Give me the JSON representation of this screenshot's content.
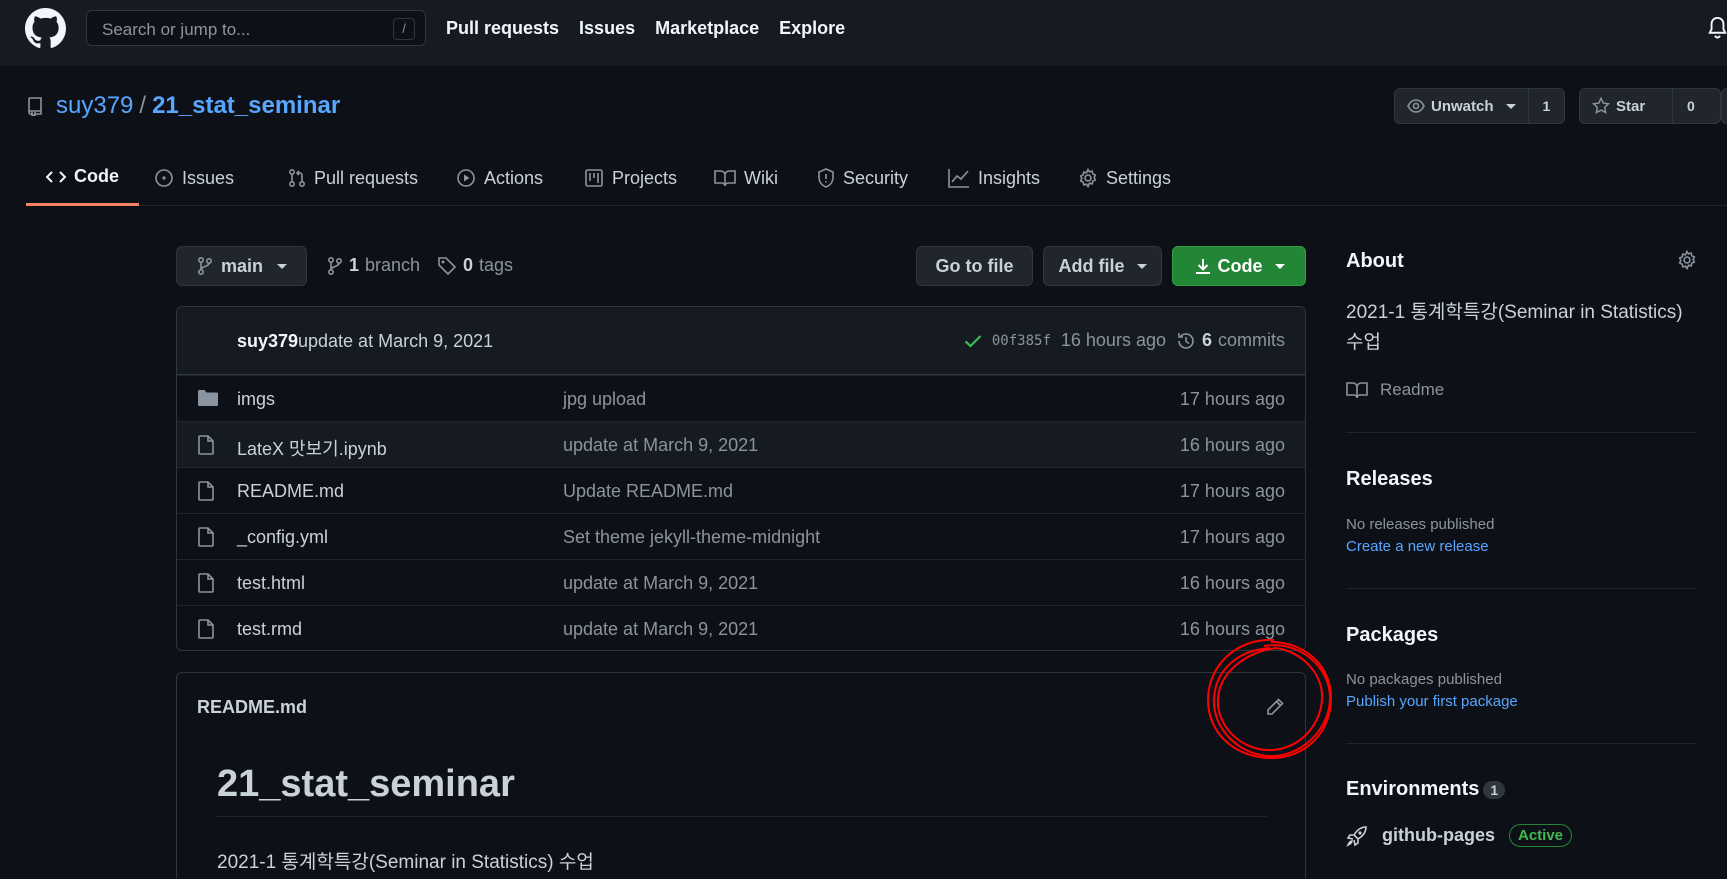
{
  "header": {
    "search_placeholder": "Search or jump to...",
    "search_shortcut": "/",
    "nav": [
      "Pull requests",
      "Issues",
      "Marketplace",
      "Explore"
    ]
  },
  "repo": {
    "owner": "suy379",
    "separator": "/",
    "name": "21_stat_seminar",
    "watch_label": "Unwatch",
    "watch_count": "1",
    "star_label": "Star",
    "star_count": "0"
  },
  "tabs": [
    {
      "label": "Code",
      "icon": "code-icon"
    },
    {
      "label": "Issues",
      "icon": "issue-icon"
    },
    {
      "label": "Pull requests",
      "icon": "pull-request-icon"
    },
    {
      "label": "Actions",
      "icon": "play-icon"
    },
    {
      "label": "Projects",
      "icon": "project-icon"
    },
    {
      "label": "Wiki",
      "icon": "book-icon"
    },
    {
      "label": "Security",
      "icon": "shield-icon"
    },
    {
      "label": "Insights",
      "icon": "graph-icon"
    },
    {
      "label": "Settings",
      "icon": "gear-icon"
    }
  ],
  "toolbar": {
    "branch": "main",
    "branch_count": "1",
    "branch_label": "branch",
    "tag_count": "0",
    "tag_label": "tags",
    "go_to_file": "Go to file",
    "add_file": "Add file",
    "code": "Code"
  },
  "commit": {
    "user": "suy379",
    "message": "update at March 9, 2021",
    "sha": "00f385f",
    "time": "16 hours ago",
    "count": "6",
    "count_label": "commits"
  },
  "files": [
    {
      "name": "imgs",
      "type": "folder",
      "message": "jpg upload",
      "age": "17 hours ago"
    },
    {
      "name": "LateX 맛보기.ipynb",
      "type": "file",
      "message": "update at March 9, 2021",
      "age": "16 hours ago"
    },
    {
      "name": "README.md",
      "type": "file",
      "message": "Update README.md",
      "age": "17 hours ago"
    },
    {
      "name": "_config.yml",
      "type": "file",
      "message": "Set theme jekyll-theme-midnight",
      "age": "17 hours ago"
    },
    {
      "name": "test.html",
      "type": "file",
      "message": "update at March 9, 2021",
      "age": "16 hours ago"
    },
    {
      "name": "test.rmd",
      "type": "file",
      "message": "update at March 9, 2021",
      "age": "16 hours ago"
    }
  ],
  "readme": {
    "file": "README.md",
    "heading": "21_stat_seminar",
    "body": "2021-1 통계학특강(Seminar in Statistics) 수업"
  },
  "sidebar": {
    "about_title": "About",
    "description": "2021-1 통계학특강(Seminar in Statistics) 수업",
    "readme_label": "Readme",
    "releases_title": "Releases",
    "releases_empty": "No releases published",
    "releases_link": "Create a new release",
    "packages_title": "Packages",
    "packages_empty": "No packages published",
    "packages_link": "Publish your first package",
    "environments_title": "Environments",
    "environments_count": "1",
    "environment_name": "github-pages",
    "environment_status": "Active"
  },
  "colors": {
    "background": "#0d1117",
    "header": "#161b22",
    "link": "#58a6ff",
    "primary_button": "#238636",
    "active_tab_underline": "#f78166",
    "annotation": "#ff0000"
  }
}
